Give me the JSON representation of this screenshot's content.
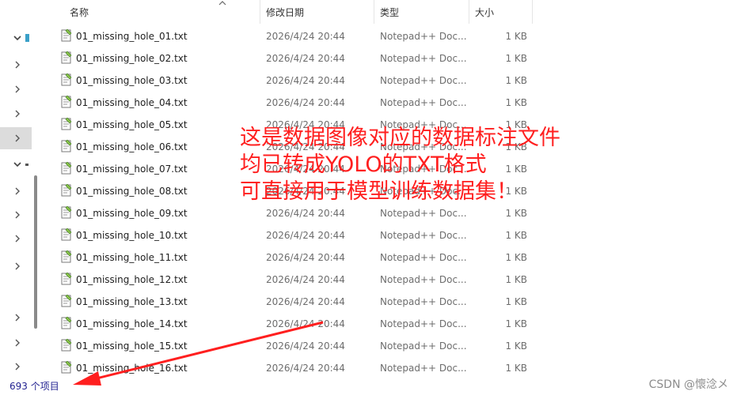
{
  "columns": {
    "name": "名称",
    "modified": "修改日期",
    "type": "类型",
    "size": "大小"
  },
  "files": [
    {
      "name": "01_missing_hole_01.txt",
      "modified": "2026/4/24 20:44",
      "type": "Notepad++ Doc...",
      "size": "1 KB"
    },
    {
      "name": "01_missing_hole_02.txt",
      "modified": "2026/4/24 20:44",
      "type": "Notepad++ Doc...",
      "size": "1 KB"
    },
    {
      "name": "01_missing_hole_03.txt",
      "modified": "2026/4/24 20:44",
      "type": "Notepad++ Doc...",
      "size": "1 KB"
    },
    {
      "name": "01_missing_hole_04.txt",
      "modified": "2026/4/24 20:44",
      "type": "Notepad++ Doc...",
      "size": "1 KB"
    },
    {
      "name": "01_missing_hole_05.txt",
      "modified": "2026/4/24 20:44",
      "type": "Notepad++ Doc...",
      "size": "1 KB"
    },
    {
      "name": "01_missing_hole_06.txt",
      "modified": "2026/4/24 20:44",
      "type": "Notepad++ Doc...",
      "size": "1 KB"
    },
    {
      "name": "01_missing_hole_07.txt",
      "modified": "2026/4/24 20:44",
      "type": "Notepad++ Doc...",
      "size": "1 KB"
    },
    {
      "name": "01_missing_hole_08.txt",
      "modified": "2026/4/24 20:44",
      "type": "Notepad++ Doc...",
      "size": "1 KB"
    },
    {
      "name": "01_missing_hole_09.txt",
      "modified": "2026/4/24 20:44",
      "type": "Notepad++ Doc...",
      "size": "1 KB"
    },
    {
      "name": "01_missing_hole_10.txt",
      "modified": "2026/4/24 20:44",
      "type": "Notepad++ Doc...",
      "size": "1 KB"
    },
    {
      "name": "01_missing_hole_11.txt",
      "modified": "2026/4/24 20:44",
      "type": "Notepad++ Doc...",
      "size": "1 KB"
    },
    {
      "name": "01_missing_hole_12.txt",
      "modified": "2026/4/24 20:44",
      "type": "Notepad++ Doc...",
      "size": "1 KB"
    },
    {
      "name": "01_missing_hole_13.txt",
      "modified": "2026/4/24 20:44",
      "type": "Notepad++ Doc...",
      "size": "1 KB"
    },
    {
      "name": "01_missing_hole_14.txt",
      "modified": "2026/4/24 20:44",
      "type": "Notepad++ Doc...",
      "size": "1 KB"
    },
    {
      "name": "01_missing_hole_15.txt",
      "modified": "2026/4/24 20:44",
      "type": "Notepad++ Doc...",
      "size": "1 KB"
    },
    {
      "name": "01_missing_hole_16.txt",
      "modified": "2026/4/24 20:44",
      "type": "Notepad++ Doc...",
      "size": "1 KB"
    }
  ],
  "status": {
    "item_count": "693 个项目"
  },
  "annotation": {
    "line1": "这是数据图像对应的数据标注文件",
    "line2": "均已转成YOLO的TXT格式",
    "line3": "可直接用于模型训练数据集！",
    "color": "#ff1f1f"
  },
  "watermark": "CSDN @懷淰メ",
  "icons": {
    "file": "notepad-file-icon",
    "chevron": "chevron-right-icon"
  }
}
